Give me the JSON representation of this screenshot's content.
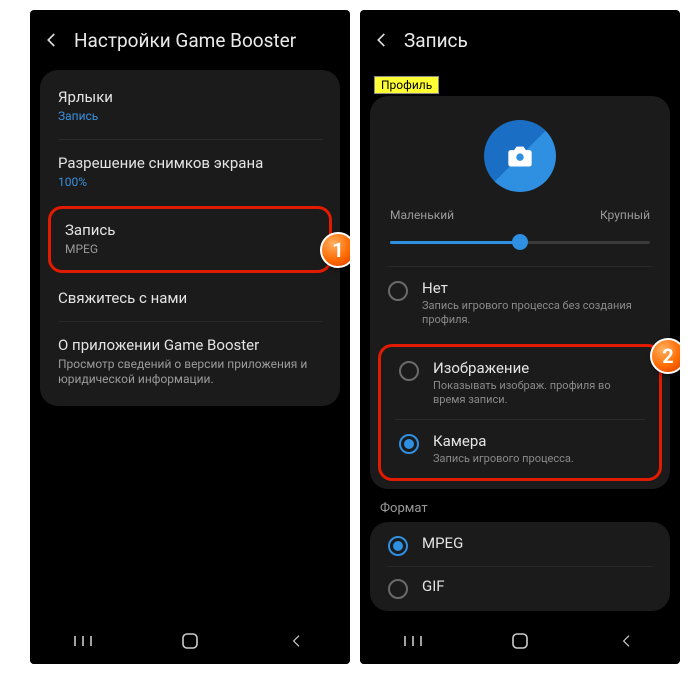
{
  "left": {
    "title": "Настройки Game Booster",
    "section": "Запись",
    "items": {
      "shortcuts": {
        "label": "Ярлыки"
      },
      "resolution": {
        "label": "Разрешение снимков экрана",
        "sub": "100%"
      },
      "record": {
        "label": "Запись",
        "sub": "MPEG"
      },
      "contact": {
        "label": "Свяжитесь с нами"
      },
      "about": {
        "label": "О приложении Game Booster",
        "sub": "Просмотр сведений о версии приложения и юридической информации."
      }
    }
  },
  "right": {
    "title": "Запись",
    "profile_label": "Профиль",
    "slider": {
      "min_label": "Маленький",
      "max_label": "Крупный"
    },
    "options": {
      "none": {
        "label": "Нет",
        "sub": "Запись игрового процесса без создания профиля."
      },
      "image": {
        "label": "Изображение",
        "sub": "Показывать изображ. профиля во время записи."
      },
      "camera": {
        "label": "Камера",
        "sub": "Запись игрового процесса."
      }
    },
    "format_label": "Формат",
    "formats": {
      "mpeg": "MPEG",
      "gif": "GIF"
    }
  },
  "callouts": {
    "one": "1",
    "two": "2"
  }
}
